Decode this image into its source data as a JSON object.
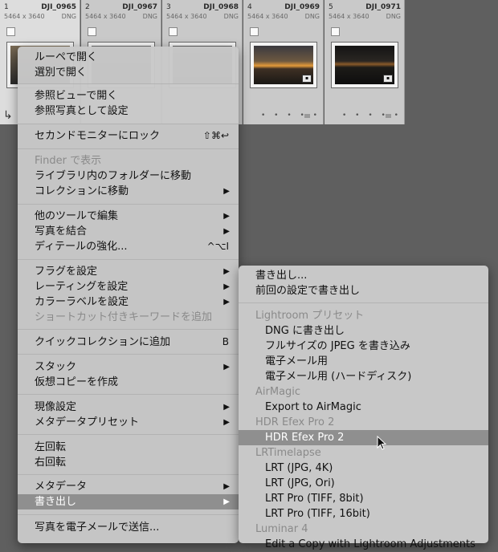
{
  "filmstrip": {
    "cells": [
      {
        "index": "1",
        "name": "DJI_0965",
        "dims": "5464 x 3640",
        "type": "DNG"
      },
      {
        "index": "2",
        "name": "DJI_0967",
        "dims": "5464 x 3640",
        "type": "DNG"
      },
      {
        "index": "3",
        "name": "DJI_0968",
        "dims": "5464 x 3640",
        "type": "DNG"
      },
      {
        "index": "4",
        "name": "DJI_0969",
        "dims": "5464 x 3640",
        "type": "DNG"
      },
      {
        "index": "5",
        "name": "DJI_0971",
        "dims": "5464 x 3640",
        "type": "DNG"
      }
    ],
    "dots": "• • • • •"
  },
  "context_menu": {
    "open_loupe": "ルーペで開く",
    "open_survey": "選別で開く",
    "open_compare": "参照ビューで開く",
    "set_reference": "参照写真として設定",
    "lock_second_monitor": "セカンドモニターにロック",
    "lock_second_monitor_shortcut": "⇧⌘↩",
    "show_in_finder": "Finder で表示",
    "go_to_folder": "ライブラリ内のフォルダーに移動",
    "go_to_collection": "コレクションに移動",
    "edit_in": "他のツールで編集",
    "photo_merge": "写真を結合",
    "enhance_details": "ディテールの強化...",
    "enhance_details_shortcut": "^⌥I",
    "set_flag": "フラグを設定",
    "set_rating": "レーティングを設定",
    "set_color_label": "カラーラベルを設定",
    "shortcut_keywords": "ショートカット付きキーワードを追加",
    "add_quick_collection": "クイックコレクションに追加",
    "add_quick_collection_shortcut": "B",
    "stack": "スタック",
    "virtual_copy": "仮想コピーを作成",
    "develop_settings": "現像設定",
    "metadata_presets": "メタデータプリセット",
    "rotate_left": "左回転",
    "rotate_right": "右回転",
    "metadata": "メタデータ",
    "export": "書き出し",
    "email_photo": "写真を電子メールで送信..."
  },
  "export_submenu": {
    "export": "書き出し...",
    "export_previous": "前回の設定で書き出し",
    "lightroom_presets_header": "Lightroom プリセット",
    "dng": "DNG に書き出し",
    "full_jpeg": "フルサイズの JPEG を書き込み",
    "email": "電子メール用",
    "email_hd": "電子メール用 (ハードディスク)",
    "airmagic_header": "AirMagic",
    "export_airmagic": "Export to AirMagic",
    "hdr_header": "HDR Efex Pro 2",
    "hdr_item": "HDR Efex Pro 2",
    "lrt_header": "LRTimelapse",
    "lrt_jpg_4k": "LRT (JPG, 4K)",
    "lrt_jpg_ori": "LRT (JPG, Ori)",
    "lrt_pro_8": "LRT Pro (TIFF, 8bit)",
    "lrt_pro_16": "LRT Pro (TIFF, 16bit)",
    "luminar_header": "Luminar 4",
    "luminar_edit": "Edit a Copy with Lightroom Adjustments"
  },
  "colors": {
    "menu_bg": "#c8c8c8",
    "highlight": "#8f8f8f",
    "disabled_text": "#8a8a8a",
    "background": "#5f5f5f"
  }
}
